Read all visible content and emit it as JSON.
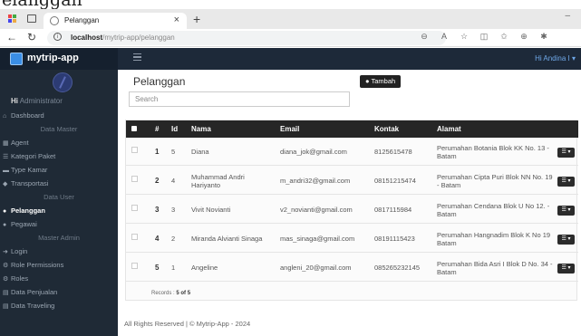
{
  "cropped_top_text": "elanggan",
  "browser": {
    "tab_title": "Pelanggan",
    "url_host": "localhost",
    "url_path": "/mytrip-app/pelanggan"
  },
  "navbar": {
    "brand": "mytrip-app",
    "user_greeting": "Hi Andina I ▾"
  },
  "sidebar": {
    "greeting_hi": "Hi",
    "greeting_role": "Administrator",
    "items": [
      {
        "type": "item",
        "label": "Dashboard",
        "icon": "home-icon",
        "glyph": "⌂",
        "active": false
      },
      {
        "type": "header",
        "label": "Data Master"
      },
      {
        "type": "item",
        "label": "Agent",
        "icon": "bank-icon",
        "glyph": "▦",
        "active": false
      },
      {
        "type": "item",
        "label": "Kategori Paket",
        "icon": "list-icon",
        "glyph": "☰",
        "active": false
      },
      {
        "type": "item",
        "label": "Type Kamar",
        "icon": "bed-icon",
        "glyph": "▬",
        "active": false
      },
      {
        "type": "item",
        "label": "Transportasi",
        "icon": "car-icon",
        "glyph": "◆",
        "active": false
      },
      {
        "type": "header",
        "label": "Data User"
      },
      {
        "type": "item",
        "label": "Pelanggan",
        "icon": "users-icon",
        "glyph": "●",
        "active": true
      },
      {
        "type": "item",
        "label": "Pegawai",
        "icon": "user-tie-icon",
        "glyph": "●",
        "active": false
      },
      {
        "type": "header",
        "label": "Master Admin"
      },
      {
        "type": "item",
        "label": "Login",
        "icon": "sign-in-icon",
        "glyph": "➜",
        "active": false
      },
      {
        "type": "item",
        "label": "Role Permissions",
        "icon": "cogs-icon",
        "glyph": "⚙",
        "active": false
      },
      {
        "type": "item",
        "label": "Roles",
        "icon": "gear-icon",
        "glyph": "⚙",
        "active": false
      },
      {
        "type": "item",
        "label": "Data Penjualan",
        "icon": "file-icon",
        "glyph": "▤",
        "active": false
      },
      {
        "type": "item",
        "label": "Data Traveling",
        "icon": "file-icon",
        "glyph": "▤",
        "active": false
      }
    ]
  },
  "main": {
    "title": "Pelanggan",
    "add_button": "Tambah",
    "search_placeholder": "Search",
    "table": {
      "headers": [
        "#",
        "Id",
        "Nama",
        "Email",
        "Kontak",
        "Alamat"
      ],
      "rows": [
        {
          "no": "1",
          "id": "5",
          "nama": "Diana",
          "email": "diana_jok@gmail.com",
          "kontak": "8125615478",
          "alamat": "Perumahan Botania Blok KK No. 13 - Batam"
        },
        {
          "no": "2",
          "id": "4",
          "nama": "Muhammad Andri Hariyanto",
          "email": "m_andri32@gmail.com",
          "kontak": "08151215474",
          "alamat": "Perumahan Cipta Puri Blok NN No. 19 - Batam"
        },
        {
          "no": "3",
          "id": "3",
          "nama": "Vivit Novianti",
          "email": "v2_novianti@gmail.com",
          "kontak": "0817115984",
          "alamat": "Perumahan Cendana Blok U No 12. - Batam"
        },
        {
          "no": "4",
          "id": "2",
          "nama": "Miranda Alvianti Sinaga",
          "email": "mas_sinaga@gmail.com",
          "kontak": "08191115423",
          "alamat": "Perumahan Hangnadim Blok K No 19 Batam"
        },
        {
          "no": "5",
          "id": "1",
          "nama": "Angeline",
          "email": "angleni_20@gmail.com",
          "kontak": "085265232145",
          "alamat": "Perumahan Bida Asri I Blok D No. 34 - Batam"
        }
      ],
      "records_label": "Records :",
      "records_value": "5 of 5"
    },
    "footer": "All Rights Reserved | © Mytrip-App - 2024"
  }
}
